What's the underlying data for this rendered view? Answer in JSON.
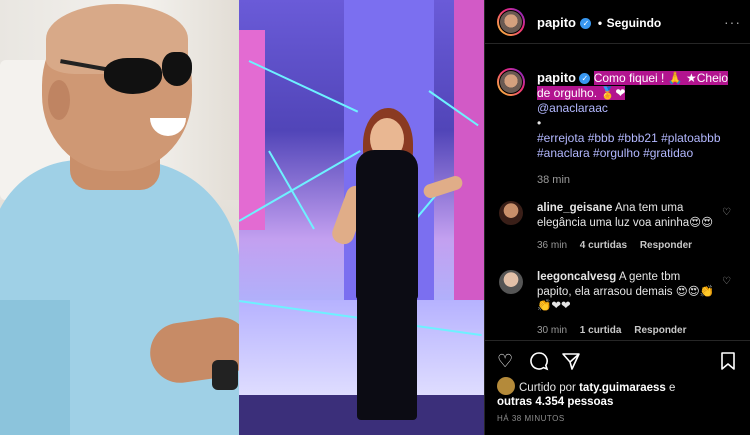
{
  "header": {
    "username": "papito",
    "separator": "•",
    "follow_status": "Seguindo",
    "more_label": "···"
  },
  "caption": {
    "username": "papito",
    "text_part1": "Como fiquei ! 🙏 ★Cheio de orgulho. 🏅❤",
    "mention": "@anaclaraac",
    "bullet": "•",
    "hashtags_line1": "#errejota #bbb #bbb21 #platoabbb",
    "hashtags_line2": "#anaclara #orgulho #gratidao",
    "time": "38 min"
  },
  "comments": [
    {
      "username": "aline_geisane",
      "text": "Ana tem uma elegância uma luz voa aninha😍😍",
      "time": "36 min",
      "likes": "4 curtidas",
      "reply": "Responder"
    },
    {
      "username": "leegoncalvesg",
      "text": "A gente tbm papito, ela arrasou demais 😍😍👏 👏❤❤",
      "time": "30 min",
      "likes": "1 curtida",
      "reply": "Responder"
    }
  ],
  "icons": [
    "heart-icon",
    "comment-icon",
    "share-icon",
    "bookmark-icon"
  ],
  "likes": {
    "prefix": "Curtido por",
    "user": "taty.guimaraess",
    "and": "e",
    "others": "outras 4.354 pessoas"
  },
  "posted_ago": "HÁ 38 MINUTOS",
  "colors": {
    "background": "#000000",
    "highlight": "#b2148f",
    "link": "#b3b8ff",
    "verified": "#3897f0"
  }
}
